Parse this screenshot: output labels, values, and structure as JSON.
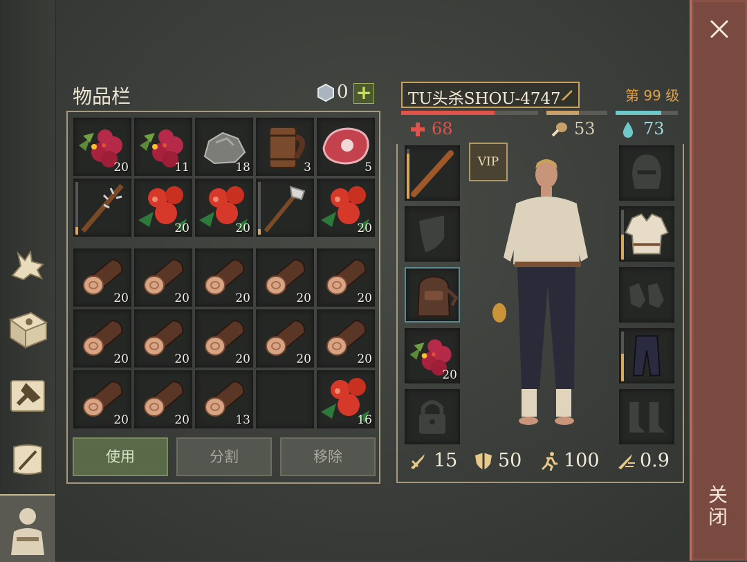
{
  "inventory": {
    "title": "物品栏",
    "currency_count": "0",
    "plus_label": "+",
    "hotbar": [
      {
        "icon": "berries-icon",
        "qty": "20"
      },
      {
        "icon": "berries-icon",
        "qty": "11"
      },
      {
        "icon": "stone-icon",
        "qty": "18"
      },
      {
        "icon": "mug-icon",
        "qty": "3"
      },
      {
        "icon": "meat-icon",
        "qty": "5"
      },
      {
        "icon": "spiked-club-icon",
        "qty": "",
        "durability": 0.15
      },
      {
        "icon": "red-berries-icon",
        "qty": "20"
      },
      {
        "icon": "red-berries-icon",
        "qty": "20"
      },
      {
        "icon": "stone-hammer-icon",
        "qty": "",
        "durability": 0.1
      },
      {
        "icon": "red-berries-icon",
        "qty": "20"
      }
    ],
    "storage": [
      {
        "icon": "log-icon",
        "qty": "20"
      },
      {
        "icon": "log-icon",
        "qty": "20"
      },
      {
        "icon": "log-icon",
        "qty": "20"
      },
      {
        "icon": "log-icon",
        "qty": "20"
      },
      {
        "icon": "log-icon",
        "qty": "20"
      },
      {
        "icon": "log-icon",
        "qty": "20"
      },
      {
        "icon": "log-icon",
        "qty": "20"
      },
      {
        "icon": "log-icon",
        "qty": "20"
      },
      {
        "icon": "log-icon",
        "qty": "20"
      },
      {
        "icon": "log-icon",
        "qty": "20"
      },
      {
        "icon": "log-icon",
        "qty": "20"
      },
      {
        "icon": "log-icon",
        "qty": "20"
      },
      {
        "icon": "log-icon",
        "qty": "13"
      },
      {
        "icon": "",
        "qty": ""
      },
      {
        "icon": "red-berries-icon",
        "qty": "16"
      }
    ],
    "buttons": {
      "use": "使用",
      "split": "分割",
      "remove": "移除"
    }
  },
  "character": {
    "name": "TU头杀SHOU-4747",
    "level": "第 99 级",
    "health": "68",
    "food": "53",
    "water": "73",
    "health_fill": 0.68,
    "food_fill": 0.53,
    "water_fill": 0.73,
    "vip": "VIP",
    "left_equip": [
      {
        "icon": "wooden-club-icon",
        "qty": "",
        "durability": 0.9
      },
      {
        "icon": "shield-placeholder-icon",
        "qty": ""
      },
      {
        "icon": "backpack-icon",
        "qty": ""
      },
      {
        "icon": "berries-icon",
        "qty": "20"
      },
      {
        "icon": "lock-icon",
        "qty": ""
      }
    ],
    "right_equip": [
      {
        "icon": "helmet-placeholder-icon"
      },
      {
        "icon": "shirt-icon",
        "durability": 0.5
      },
      {
        "icon": "gloves-placeholder-icon"
      },
      {
        "icon": "pants-icon",
        "durability": 0.55
      },
      {
        "icon": "boots-placeholder-icon"
      }
    ],
    "bottom_stats": {
      "attack": "15",
      "defense": "50",
      "speed": "100",
      "attack_speed": "0.9"
    }
  },
  "side_nav": [
    "wolf-icon",
    "sun-book-icon",
    "crafting-hammer-icon",
    "scroll-quill-icon",
    "character-icon"
  ],
  "close": {
    "label": "关闭"
  },
  "colors": {
    "health": "#e0524a",
    "food": "#c9a06a",
    "water": "#6ec7c9",
    "level": "#e3a14a"
  }
}
